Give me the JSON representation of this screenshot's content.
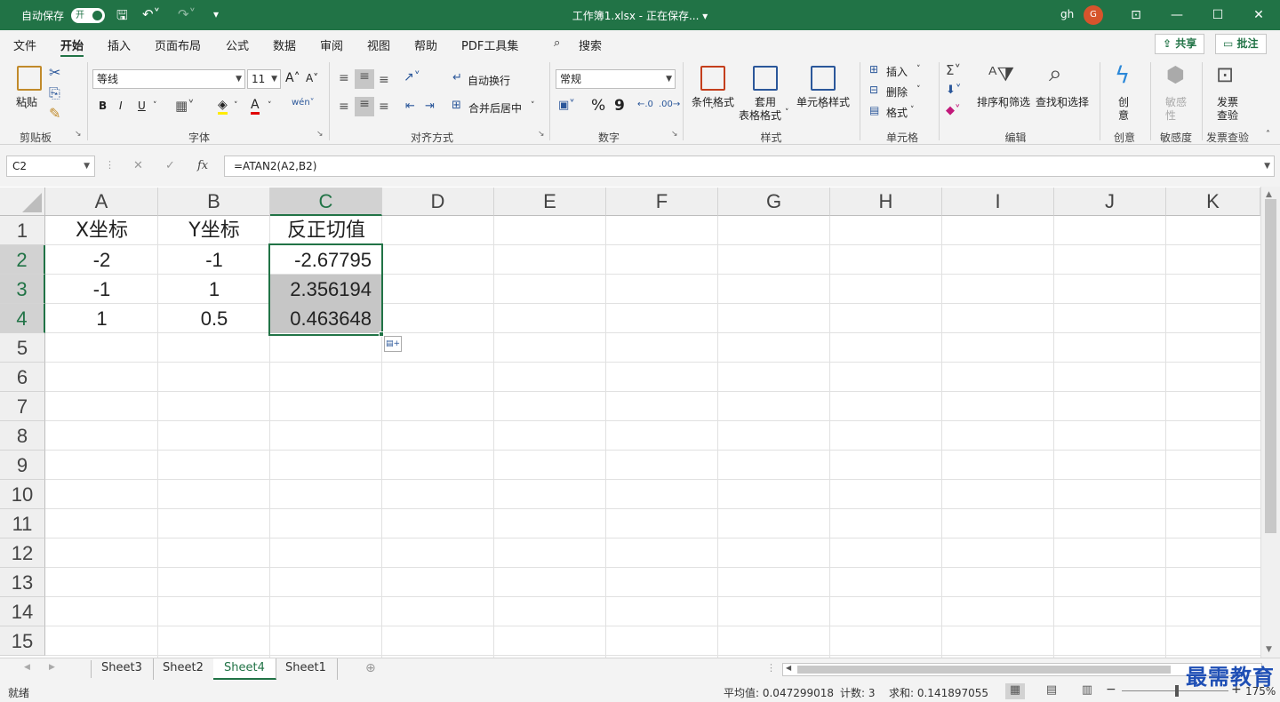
{
  "titlebar": {
    "autosave_label": "自动保存",
    "autosave_toggle": "开",
    "title": "工作簿1.xlsx - 正在保存... ▾",
    "user": "gh",
    "avatar": "G"
  },
  "menu": {
    "tabs": [
      "文件",
      "开始",
      "插入",
      "页面布局",
      "公式",
      "数据",
      "审阅",
      "视图",
      "帮助",
      "PDF工具集",
      "搜索"
    ],
    "share": "共享",
    "comment": "批注"
  },
  "ribbon": {
    "clipboard": {
      "label": "剪贴板",
      "paste": "粘贴"
    },
    "font": {
      "label": "字体",
      "font_name": "等线",
      "font_size": "11",
      "bold": "B",
      "italic": "I",
      "underline": "U"
    },
    "alignment": {
      "label": "对齐方式",
      "wrap": "自动换行",
      "merge": "合并后居中"
    },
    "number": {
      "label": "数字",
      "format": "常规",
      "percent": "%",
      "comma": "9"
    },
    "styles": {
      "label": "样式",
      "conditional": "条件格式",
      "table1": "套用",
      "table2": "表格格式",
      "cell_styles": "单元格样式"
    },
    "cells": {
      "label": "单元格",
      "insert": "插入",
      "delete": "删除",
      "format": "格式"
    },
    "editing": {
      "label": "编辑",
      "sort": "排序和筛选",
      "find": "查找和选择"
    },
    "ideas": {
      "label": "创意",
      "btn1": "创",
      "btn2": "意"
    },
    "sensitivity": {
      "label": "敏感度",
      "btn1": "敏感",
      "btn2": "性"
    },
    "invoice": {
      "label": "发票查验",
      "btn1": "发票",
      "btn2": "查验"
    }
  },
  "formula_bar": {
    "name_box": "C2",
    "fx": "fx",
    "formula": "=ATAN2(A2,B2)"
  },
  "columns": [
    "A",
    "B",
    "C",
    "D",
    "E",
    "F",
    "G",
    "H",
    "I",
    "J",
    "K"
  ],
  "rows": [
    "1",
    "2",
    "3",
    "4",
    "5",
    "6",
    "7",
    "8",
    "9",
    "10",
    "11",
    "12",
    "13",
    "14",
    "15"
  ],
  "cells": {
    "A1": "X坐标",
    "B1": "Y坐标",
    "C1": "反正切值",
    "A2": "-2",
    "B2": "-1",
    "C2": "-2.67795",
    "A3": "-1",
    "B3": "1",
    "C3": "2.356194",
    "A4": "1",
    "B4": "0.5",
    "C4": "0.463648"
  },
  "sheets": [
    "Sheet3",
    "Sheet2",
    "Sheet4",
    "Sheet1"
  ],
  "active_sheet": "Sheet4",
  "status": {
    "mode": "就绪",
    "average": "平均值: 0.047299018",
    "count": "计数: 3",
    "sum": "求和: 0.141897055",
    "zoom": "175%"
  },
  "watermark": "最需教育",
  "colors": {
    "accent": "#217346",
    "selection": "#c6c6c6"
  }
}
